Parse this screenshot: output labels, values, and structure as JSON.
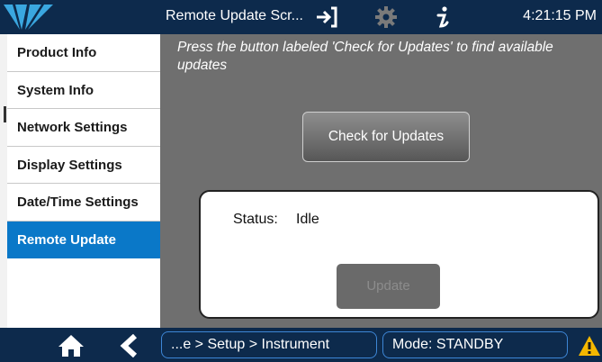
{
  "header": {
    "title": "Remote Update Scr...",
    "time": "4:21:15 PM",
    "icons": [
      "teledyne-logo-icon",
      "sign-in-icon",
      "gear-icon",
      "info-icon"
    ]
  },
  "sidebar": {
    "items": [
      {
        "label": "Product Info",
        "active": false
      },
      {
        "label": "System Info",
        "active": false
      },
      {
        "label": "Network Settings",
        "active": false
      },
      {
        "label": "Display Settings",
        "active": false
      },
      {
        "label": "Date/Time Settings",
        "active": false
      },
      {
        "label": "Remote Update",
        "active": true
      }
    ]
  },
  "main": {
    "instructions": "Press the button labeled 'Check for Updates' to find available updates",
    "check_button": "Check for Updates",
    "status_label": "Status:",
    "status_value": "Idle",
    "update_button": "Update"
  },
  "footer": {
    "breadcrumb": "...e > Setup > Instrument",
    "mode": "Mode: STANDBY",
    "icons": [
      "home-icon",
      "back-icon",
      "warning-icon"
    ]
  },
  "colors": {
    "header_bg": "#0d2a4c",
    "active_item": "#0a78c8",
    "main_bg": "#6f6f6f",
    "warning": "#f5b800"
  }
}
